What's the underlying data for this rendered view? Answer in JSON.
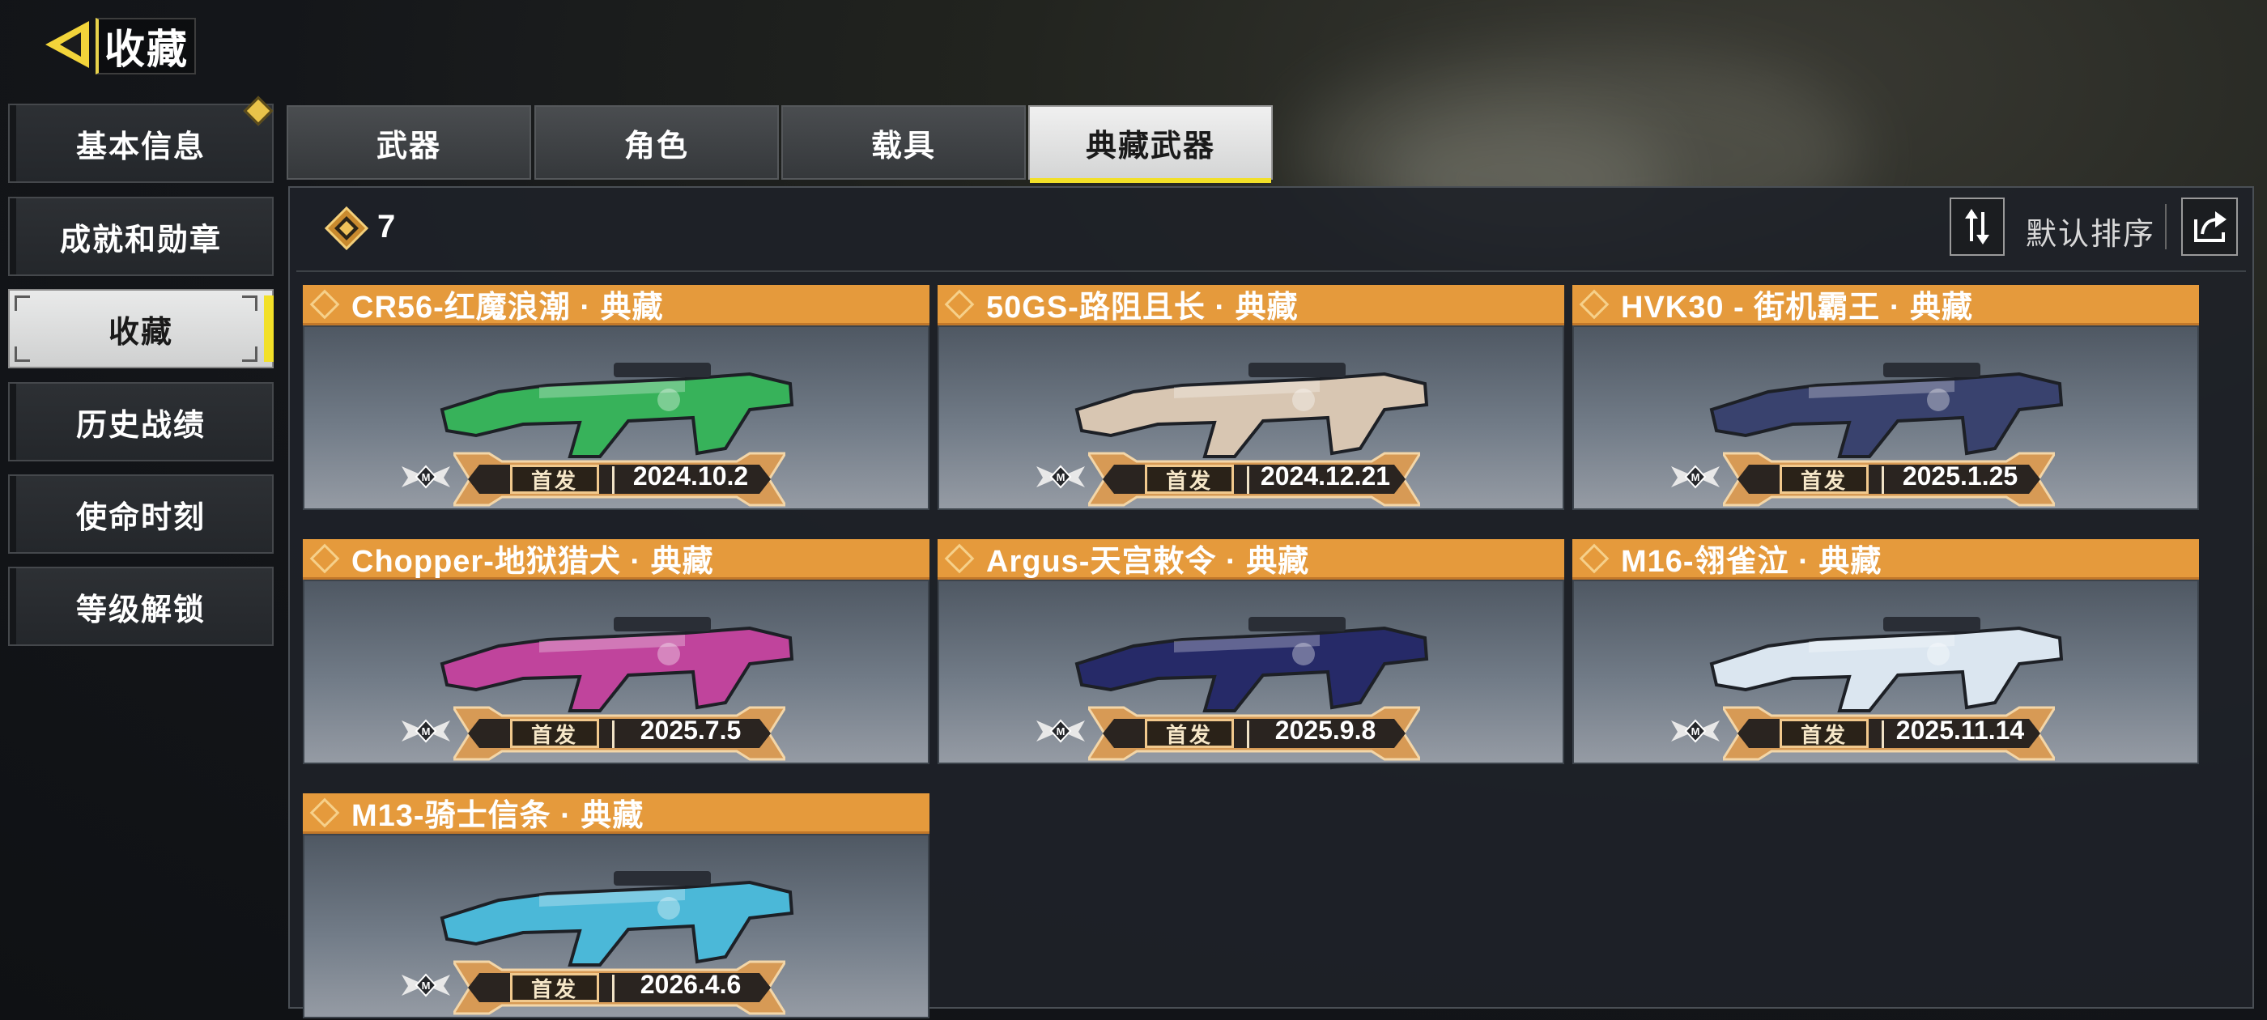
{
  "header": {
    "title": "收藏"
  },
  "sidebar": {
    "items": [
      {
        "label": "基本信息",
        "active": false,
        "has_new": true
      },
      {
        "label": "成就和勋章",
        "active": false
      },
      {
        "label": "收藏",
        "active": true
      },
      {
        "label": "历史战绩",
        "active": false
      },
      {
        "label": "使命时刻",
        "active": false
      },
      {
        "label": "等级解锁",
        "active": false
      }
    ]
  },
  "tabs": [
    {
      "label": "武器",
      "active": false
    },
    {
      "label": "角色",
      "active": false
    },
    {
      "label": "载具",
      "active": false
    },
    {
      "label": "典藏武器",
      "active": true
    }
  ],
  "toolbar": {
    "count": "7",
    "sort_label": "默认排序"
  },
  "colors": {
    "accent_yellow": "#f2e028",
    "card_orange": "#e59a3c",
    "plaque_gold": "#d79a55"
  },
  "cards": [
    {
      "title": "CR56-红魔浪潮 · 典藏",
      "badge": "首发",
      "date": "2024.10.2",
      "gun_color": "#37b25a"
    },
    {
      "title": "50GS-路阻且长 · 典藏",
      "badge": "首发",
      "date": "2024.12.21",
      "gun_color": "#d8c6b2"
    },
    {
      "title": "HVK30 - 街机霸王 · 典藏",
      "badge": "首发",
      "date": "2025.1.25",
      "gun_color": "#39426e"
    },
    {
      "title": "Chopper-地狱猎犬 · 典藏",
      "badge": "首发",
      "date": "2025.7.5",
      "gun_color": "#c0449c"
    },
    {
      "title": "Argus-天宫敕令 · 典藏",
      "badge": "首发",
      "date": "2025.9.8",
      "gun_color": "#262a68"
    },
    {
      "title": "M16-翎雀泣 · 典藏",
      "badge": "首发",
      "date": "2025.11.14",
      "gun_color": "#dbe6f0"
    },
    {
      "title": "M13-骑士信条 · 典藏",
      "badge": "首发",
      "date": "2026.4.6",
      "gun_color": "#4bb8d8"
    }
  ]
}
